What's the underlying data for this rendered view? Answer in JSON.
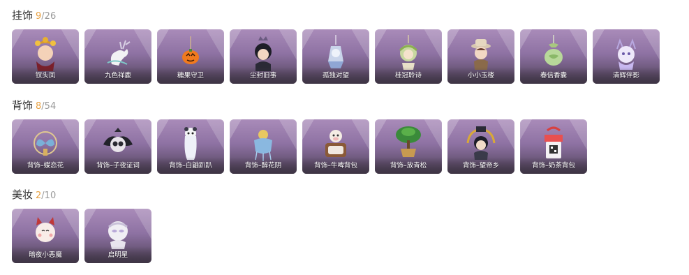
{
  "sections": [
    {
      "title": "挂饰",
      "owned": "9",
      "total": "/26",
      "items": [
        {
          "label": "钗头凤",
          "icon": "flower-crown-doll-icon"
        },
        {
          "label": "九色祥鹿",
          "icon": "white-deer-icon"
        },
        {
          "label": "糖果守卫",
          "icon": "pumpkin-guard-icon"
        },
        {
          "label": "尘封旧事",
          "icon": "crowned-boy-icon"
        },
        {
          "label": "孤独对望",
          "icon": "silver-charm-icon"
        },
        {
          "label": "桂冠聆诗",
          "icon": "laurel-doll-icon"
        },
        {
          "label": "小小玉楼",
          "icon": "hat-boy-icon"
        },
        {
          "label": "春信香囊",
          "icon": "green-sachet-icon"
        },
        {
          "label": "清辉伴影",
          "icon": "purple-spirit-icon"
        }
      ]
    },
    {
      "title": "背饰",
      "owned": "8",
      "total": "/54",
      "items": [
        {
          "label": "背饰–蝶恋花",
          "icon": "butterfly-ring-icon"
        },
        {
          "label": "背饰–子夜证词",
          "icon": "black-owl-icon"
        },
        {
          "label": "背饰–白鼬趴趴",
          "icon": "white-ferret-icon"
        },
        {
          "label": "背饰–醉花阴",
          "icon": "blue-flower-lantern-icon"
        },
        {
          "label": "背饰–牛啤背包",
          "icon": "cow-backpack-icon"
        },
        {
          "label": "背饰–放青松",
          "icon": "pine-bonsai-icon"
        },
        {
          "label": "背饰–望帝乡",
          "icon": "gold-crown-icon"
        },
        {
          "label": "背饰–奶茶背包",
          "icon": "milk-tea-bag-icon"
        }
      ]
    },
    {
      "title": "美妆",
      "owned": "2",
      "total": "/10",
      "items": [
        {
          "label": "暗夜小恶魔",
          "icon": "devil-face-icon"
        },
        {
          "label": "启明星",
          "icon": "star-mask-icon"
        }
      ]
    }
  ],
  "colors": {
    "accent_owned": "#e8a040",
    "count_gray": "#999999",
    "card_top": "#a98bb9",
    "card_bottom": "#4a3f52"
  }
}
